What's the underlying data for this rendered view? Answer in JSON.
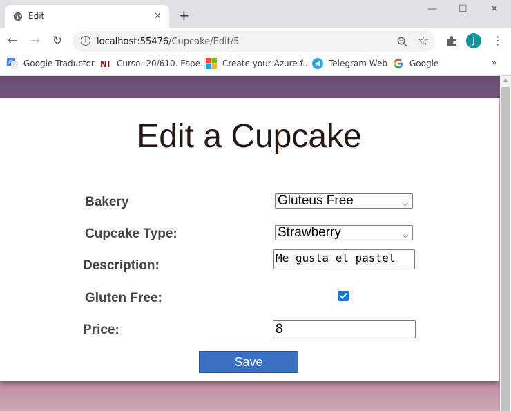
{
  "browser": {
    "tab": {
      "title": "Edit",
      "close": "✕",
      "icon": "globe-icon"
    },
    "new_tab": "+",
    "window_controls": {
      "minimize": "—",
      "maximize": "☐",
      "close": "✕"
    },
    "url_host": "localhost:55476",
    "url_path": "/Cupcake/Edit/5",
    "avatar_letter": "J",
    "avatar_color": "#12939a",
    "bookmarks": [
      {
        "label": "Google Traductor",
        "icon": "google-translate-icon"
      },
      {
        "label": "Curso: 20/610. Espe...",
        "icon": "ni-icon"
      },
      {
        "label": "Create your Azure f...",
        "icon": "microsoft-icon"
      },
      {
        "label": "Telegram Web",
        "icon": "telegram-icon"
      },
      {
        "label": "Google",
        "icon": "google-icon"
      }
    ],
    "bookmarks_more": "»"
  },
  "page": {
    "title": "Edit a Cupcake",
    "form": {
      "bakery_label": "Bakery",
      "bakery_value": "Gluteus Free",
      "type_label": "Cupcake Type:",
      "type_value": "Strawberry",
      "description_label": "Description:",
      "description_value": "Me gusta el pastel",
      "gluten_label": "Gluten Free:",
      "gluten_checked": true,
      "price_label": "Price:",
      "price_value": "8",
      "save_label": "Save"
    },
    "colors": {
      "header_band": "#6b4a72",
      "footer_band": "#c08ea8",
      "save_button": "#3a6fc2",
      "checkbox": "#0b74e4"
    }
  }
}
